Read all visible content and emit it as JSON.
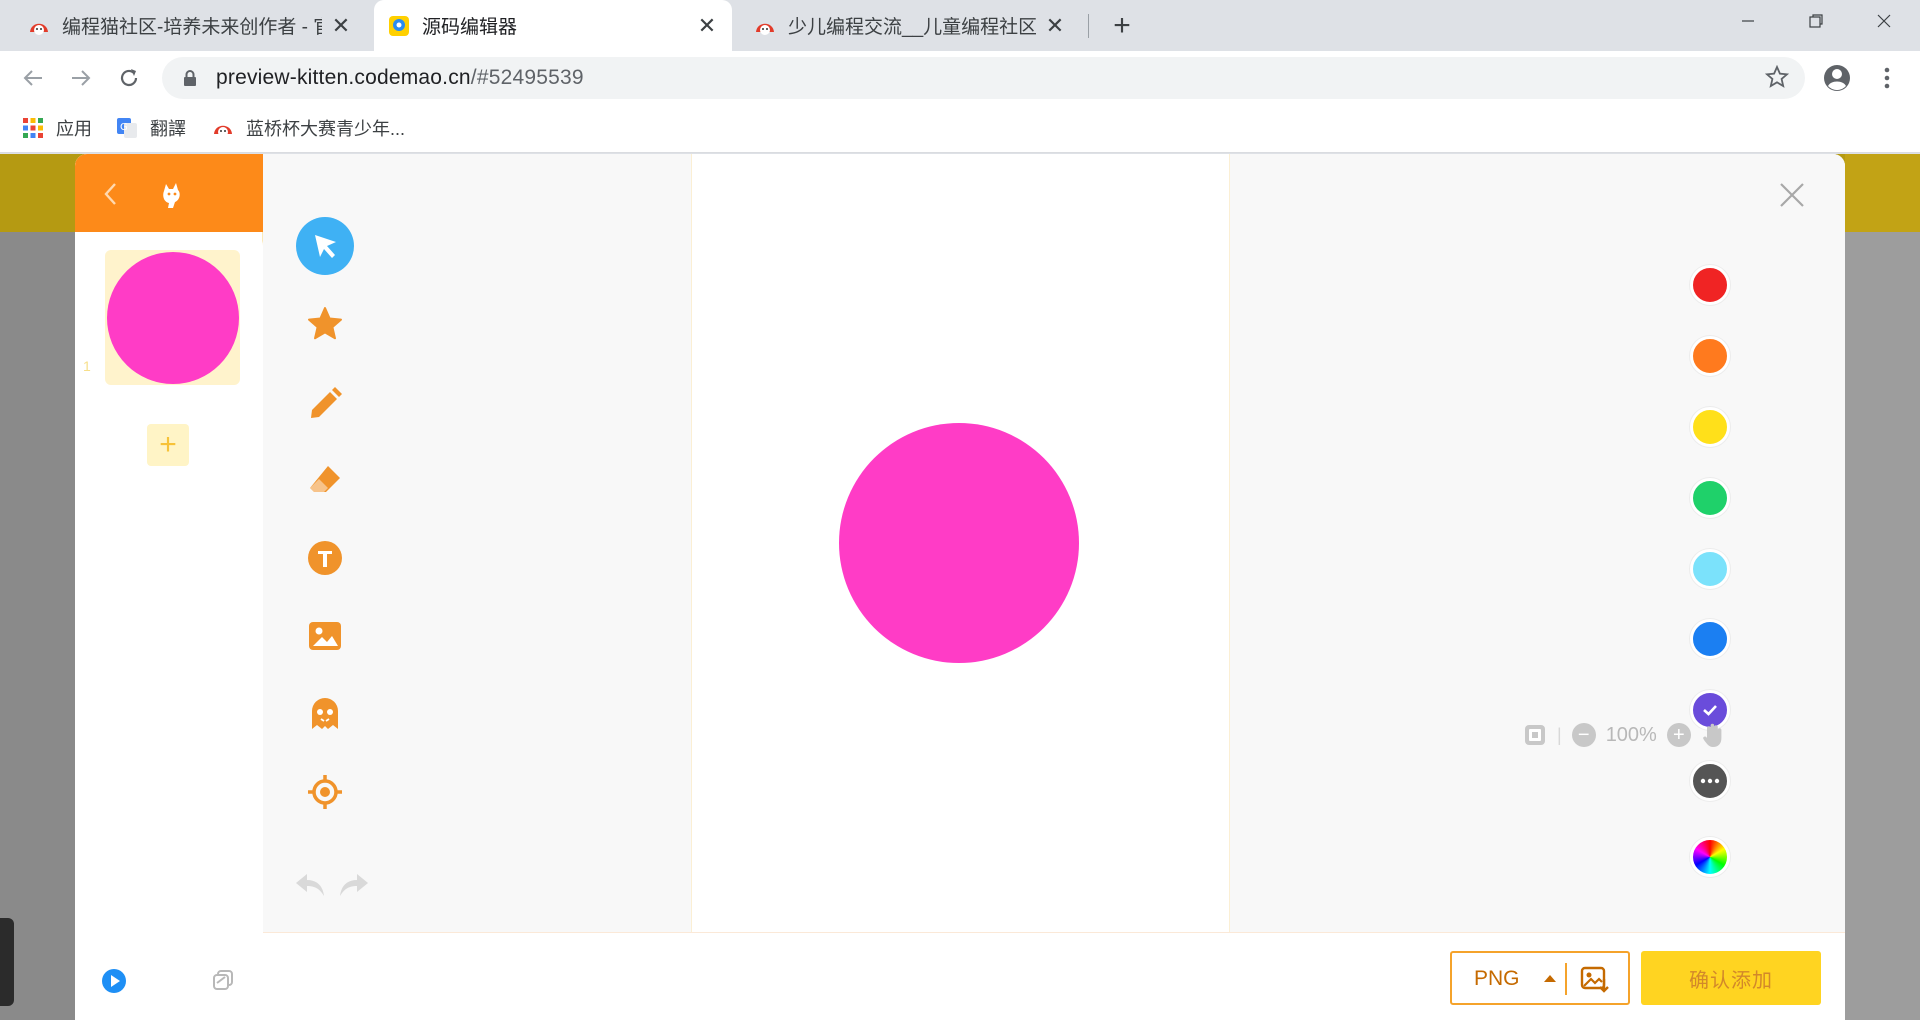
{
  "browser": {
    "tabs": [
      {
        "title": "编程猫社区-培养未来创作者 - 官方",
        "active": false
      },
      {
        "title": "源码编辑器",
        "active": true
      },
      {
        "title": "少儿编程交流__儿童编程社区_scratch",
        "active": false
      }
    ],
    "new_tab_label": "+",
    "url_host": "preview-kitten.codemao.cn",
    "url_path": "/#52495539",
    "bookmarks": [
      {
        "label": "应用",
        "icon": "apps-grid-icon"
      },
      {
        "label": "翻譯",
        "icon": "google-translate-icon"
      },
      {
        "label": "蓝桥杯大赛青少年...",
        "icon": "codemao-icon"
      }
    ]
  },
  "editor": {
    "frame_index": "1",
    "add_frame_label": "+",
    "tools": [
      "select-tool",
      "shape-tool",
      "pencil-tool",
      "eraser-tool",
      "text-tool",
      "image-tool",
      "character-tool",
      "center-tool"
    ],
    "colors": [
      "#f02424",
      "#ff7a1e",
      "#ffe01a",
      "#1fd16a",
      "#7be2fb",
      "#1b7ff2",
      "#6a4cdb",
      "#555555"
    ],
    "selected_color": "#6a4cdb",
    "canvas_shape_color": "#ff3cc6",
    "zoom_text": "100%",
    "format_value": "PNG",
    "confirm_label": "确认添加"
  }
}
